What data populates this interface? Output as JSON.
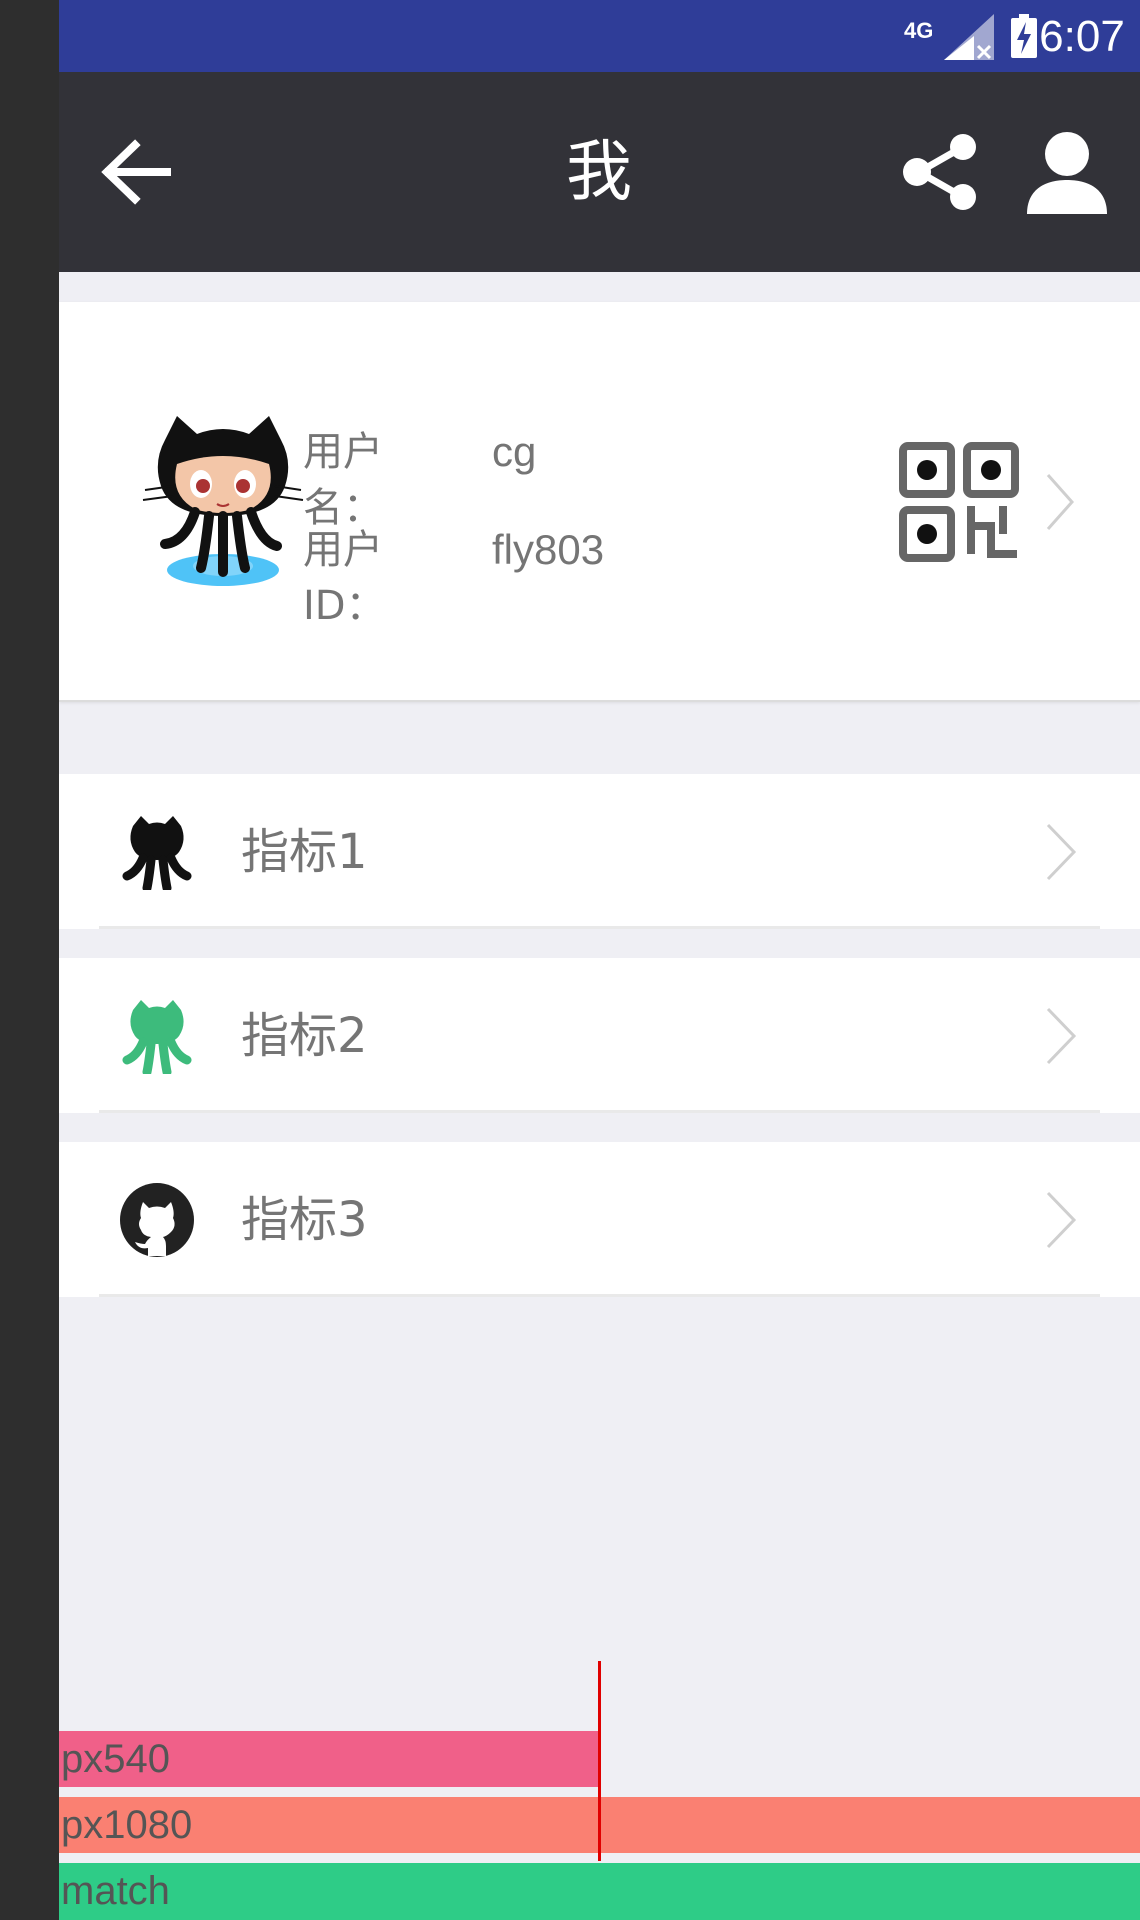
{
  "status_bar": {
    "network": "4G",
    "time": "6:07"
  },
  "app_bar": {
    "title": "我"
  },
  "profile": {
    "username_label": "用户名：",
    "username": "cg",
    "userid_label": "用户ID：",
    "userid": "fly803"
  },
  "menu": {
    "items": [
      {
        "label": "指标1",
        "icon": "octocat-dark-icon"
      },
      {
        "label": "指标2",
        "icon": "octocat-green-icon"
      },
      {
        "label": "指标3",
        "icon": "github-logo-icon"
      }
    ]
  },
  "demo_bars": [
    {
      "label": "px540",
      "color": "#f06089"
    },
    {
      "label": "px1080",
      "color": "#fa8072"
    },
    {
      "label": "match",
      "color": "#2ecc87"
    }
  ],
  "colors": {
    "status_bar": "#2f3d98",
    "app_bar": "#323238",
    "background": "#efeff4",
    "text": "#757575",
    "divider": "#e9e9e9",
    "card_border": "#dcdcdc"
  }
}
